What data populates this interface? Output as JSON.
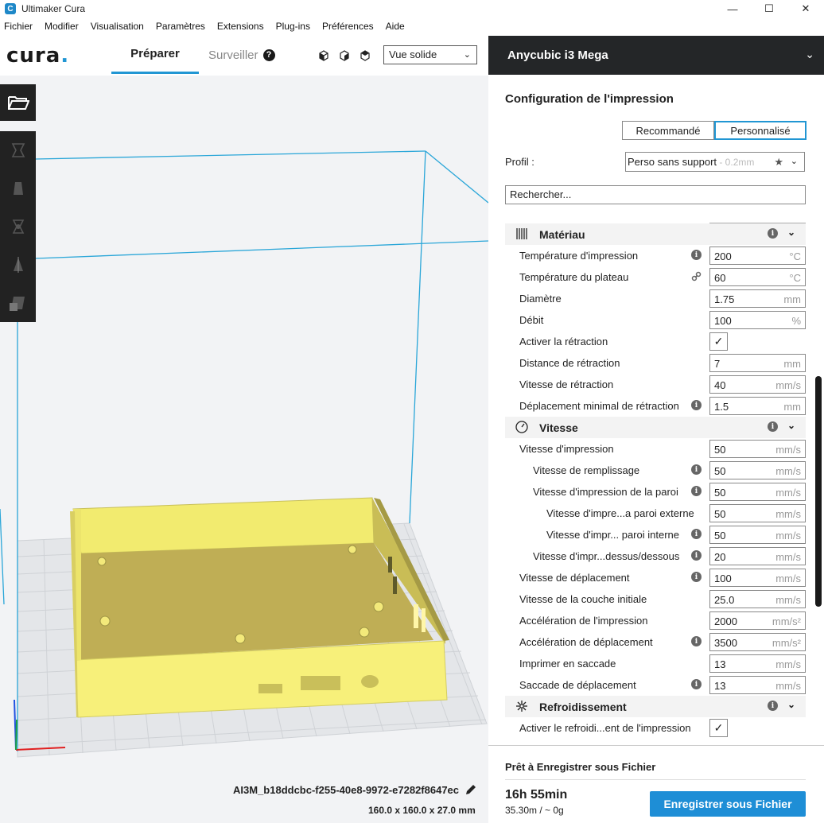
{
  "window": {
    "title": "Ultimaker Cura",
    "app_icon_letter": "C",
    "minimize": "—",
    "maximize": "☐",
    "close": "✕"
  },
  "menu": [
    "Fichier",
    "Modifier",
    "Visualisation",
    "Paramètres",
    "Extensions",
    "Plug-ins",
    "Préférences",
    "Aide"
  ],
  "header": {
    "logo": "cura",
    "logo_dot": ".",
    "tab_prepare": "Préparer",
    "tab_monitor": "Surveiller",
    "help": "?",
    "view_mode": "Vue solide",
    "chevron": "⌄"
  },
  "viewport": {
    "filename": "AI3M_b18ddcbc-f255-40e8-9972-e7282f8647ec",
    "dimensions": "160.0 x 160.0 x 27.0 mm",
    "model_color": "#f5ee7e",
    "grid_color": "#cfd2d6",
    "build_volume_color": "#2aa6d8"
  },
  "panel": {
    "printer": "Anycubic i3 Mega",
    "config_title": "Configuration de l'impression",
    "mode_recommended": "Recommandé",
    "mode_custom": "Personnalisé",
    "profile_label": "Profil :",
    "profile_name": "Perso sans support",
    "profile_sub": " - 0.2mm",
    "star": "★",
    "search_placeholder": "Rechercher...",
    "info_glyph": "i",
    "caret": "⌄",
    "check": "✓"
  },
  "settings": {
    "material": {
      "label": "Matériau",
      "icon": "material-icon",
      "rows": [
        {
          "label": "Température d'impression",
          "value": "200",
          "unit": "°C",
          "icon": "info"
        },
        {
          "label": "Température du plateau",
          "value": "60",
          "unit": "°C",
          "icon": "link"
        },
        {
          "label": "Diamètre",
          "value": "1.75",
          "unit": "mm"
        },
        {
          "label": "Débit",
          "value": "100",
          "unit": "%"
        },
        {
          "label": "Activer la rétraction",
          "checkbox": true
        },
        {
          "label": "Distance de rétraction",
          "value": "7",
          "unit": "mm"
        },
        {
          "label": "Vitesse de rétraction",
          "value": "40",
          "unit": "mm/s"
        },
        {
          "label": "Déplacement minimal de rétraction",
          "value": "1.5",
          "unit": "mm",
          "icon": "info"
        }
      ]
    },
    "speed": {
      "label": "Vitesse",
      "icon": "speed-gauge-icon",
      "rows": [
        {
          "label": "Vitesse d'impression",
          "value": "50",
          "unit": "mm/s",
          "indent": 0
        },
        {
          "label": "Vitesse de remplissage",
          "value": "50",
          "unit": "mm/s",
          "indent": 1,
          "icon": "info"
        },
        {
          "label": "Vitesse d'impression de la paroi",
          "value": "50",
          "unit": "mm/s",
          "indent": 1,
          "icon": "info"
        },
        {
          "label": "Vitesse d'impre...a paroi externe",
          "value": "50",
          "unit": "mm/s",
          "indent": 2
        },
        {
          "label": "Vitesse d'impr... paroi interne",
          "value": "50",
          "unit": "mm/s",
          "indent": 2,
          "icon": "info"
        },
        {
          "label": "Vitesse d'impr...dessus/dessous",
          "value": "20",
          "unit": "mm/s",
          "indent": 1,
          "icon": "info"
        },
        {
          "label": "Vitesse de déplacement",
          "value": "100",
          "unit": "mm/s",
          "indent": 0,
          "icon": "info"
        },
        {
          "label": "Vitesse de la couche initiale",
          "value": "25.0",
          "unit": "mm/s",
          "indent": 0
        },
        {
          "label": "Accélération de l'impression",
          "value": "2000",
          "unit": "mm/s²",
          "indent": 0
        },
        {
          "label": "Accélération de déplacement",
          "value": "3500",
          "unit": "mm/s²",
          "indent": 0,
          "icon": "info"
        },
        {
          "label": "Imprimer en saccade",
          "value": "13",
          "unit": "mm/s",
          "indent": 0
        },
        {
          "label": "Saccade de déplacement",
          "value": "13",
          "unit": "mm/s",
          "indent": 0,
          "icon": "info"
        }
      ]
    },
    "cooling": {
      "label": "Refroidissement",
      "icon": "fan-icon",
      "rows": [
        {
          "label": "Activer le refroidi...ent de l'impression",
          "checkbox": true
        }
      ]
    }
  },
  "footer": {
    "ready": "Prêt à Enregistrer sous Fichier",
    "time": "16h 55min",
    "material": "35.30m / ~ 0g",
    "save": "Enregistrer sous Fichier"
  }
}
